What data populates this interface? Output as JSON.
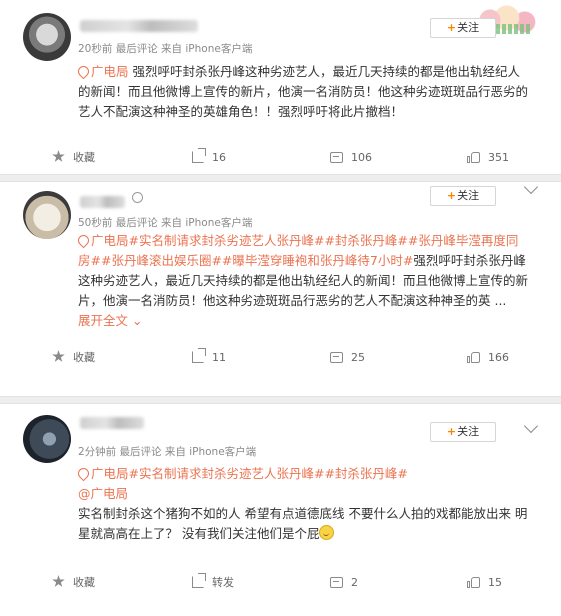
{
  "posts": [
    {
      "time": "20秒前",
      "meta_tail": "最后评论 来自 iPhone客户端",
      "follow_label": "关注",
      "location": "广电局",
      "text": "强烈呼吁封杀张丹峰这种劣迹艺人，最近几天持续的都是他出轨经纪人的新闻！而且他微博上宣传的新片，他演一名消防员！他这种劣迹斑斑品行恶劣的艺人不配演这种神圣的英雄角色！！强烈呼吁将此片撤档！",
      "actions": {
        "favorite": "收藏",
        "share": "16",
        "comment": "106",
        "like": "351"
      }
    },
    {
      "time": "50秒前",
      "meta_tail": "最后评论 来自 iPhone客户端",
      "follow_label": "关注",
      "location": "广电局",
      "tags": "#实名制请求封杀劣迹艺人张丹峰##封杀张丹峰##张丹峰毕滢再度同房##张丹峰滚出娱乐圈##曝毕滢穿睡袍和张丹峰待7小时#",
      "text": "强烈呼吁封杀张丹峰这种劣迹艺人，最近几天持续的都是他出轨经纪人的新闻！而且他微博上宣传的新片，他演一名消防员！他这种劣迹斑斑品行恶劣的艺人不配演这种神圣的英 ...",
      "expand": "展开全文",
      "actions": {
        "favorite": "收藏",
        "share": "11",
        "comment": "25",
        "like": "166"
      }
    },
    {
      "time": "2分钟前",
      "meta_tail": "最后评论 来自 iPhone客户端",
      "follow_label": "关注",
      "location": "广电局",
      "tags": "#实名制请求封杀劣迹艺人张丹峰##封杀张丹峰#",
      "mention": "@广电局",
      "text": "实名制封杀这个猪狗不如的人 希望有点道德底线 不要什么人拍的戏都能放出来 明星就高高在上了？ 没有我们关注他们是个屁",
      "actions": {
        "favorite": "收藏",
        "share": "转发",
        "comment": "2",
        "like": "15"
      }
    }
  ],
  "colors": {
    "accent": "#eb7350",
    "follow_plus": "#ff8200",
    "meta": "#8a8a8a"
  },
  "icons": [
    "location-icon",
    "star-icon",
    "share-icon",
    "comment-icon",
    "like-icon",
    "chevron-down-icon",
    "smiley-icon",
    "vip-icon"
  ]
}
